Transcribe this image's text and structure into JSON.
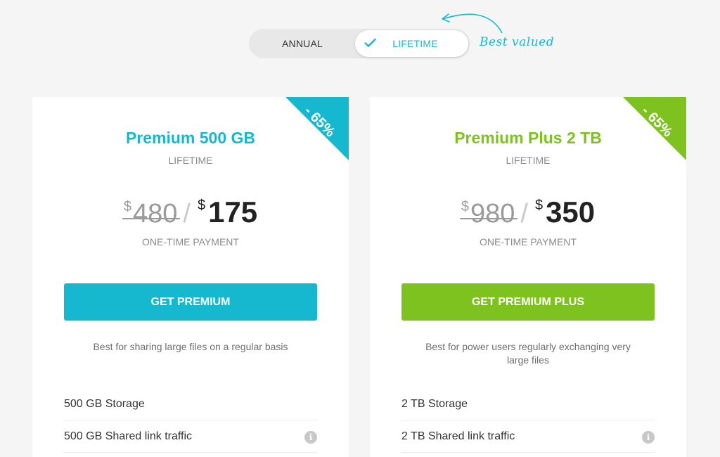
{
  "toggle": {
    "annual_label": "ANNUAL",
    "lifetime_label": "LIFETIME",
    "selected": "LIFETIME"
  },
  "best_valued": "Best valued",
  "colors": {
    "teal": "#16b8cf",
    "green": "#7dc21e"
  },
  "plans": [
    {
      "discount": "- 65%",
      "title": "Premium 500 GB",
      "term": "LIFETIME",
      "currency": "$",
      "old_price": "480",
      "new_price": "175",
      "payment_note": "ONE-TIME PAYMENT",
      "cta_label": "GET PREMIUM",
      "description": "Best for sharing large files on a regular basis",
      "features": [
        "500 GB Storage",
        "500 GB Shared link traffic"
      ]
    },
    {
      "discount": "- 65%",
      "title": "Premium Plus 2 TB",
      "term": "LIFETIME",
      "currency": "$",
      "old_price": "980",
      "new_price": "350",
      "payment_note": "ONE-TIME PAYMENT",
      "cta_label": "GET PREMIUM PLUS",
      "description": "Best for power users regularly exchanging very large files",
      "features": [
        "2 TB Storage",
        "2 TB Shared link traffic"
      ]
    }
  ]
}
